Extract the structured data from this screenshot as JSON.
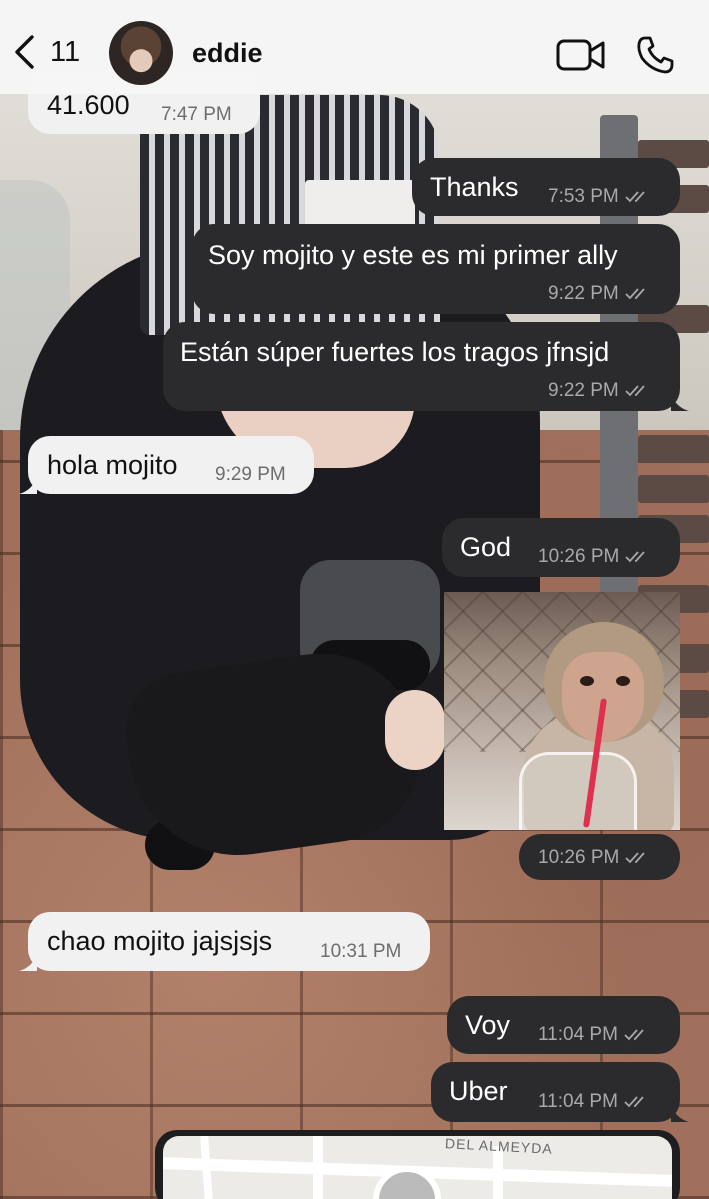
{
  "header": {
    "back_count": "11",
    "contact_name": "eddie"
  },
  "messages": [
    {
      "direction": "in",
      "text": "41.600",
      "time": "7:47 PM"
    },
    {
      "direction": "out",
      "text": "Thanks",
      "time": "7:53 PM",
      "status": "read"
    },
    {
      "direction": "out",
      "text": "Soy mojito y este es mi primer ally",
      "time": "9:22 PM",
      "status": "read"
    },
    {
      "direction": "out",
      "text": "Están súper fuertes los tragos jfnsjd",
      "time": "9:22 PM",
      "status": "read"
    },
    {
      "direction": "in",
      "text": "hola mojito",
      "time": "9:29 PM"
    },
    {
      "direction": "out",
      "text": "God",
      "time": "10:26 PM",
      "status": "read"
    },
    {
      "direction": "out",
      "type": "image",
      "time": "10:26 PM",
      "status": "read"
    },
    {
      "direction": "in",
      "text": "chao mojito jajsjsjs",
      "time": "10:31 PM"
    },
    {
      "direction": "out",
      "text": "Voy",
      "time": "11:04 PM",
      "status": "read"
    },
    {
      "direction": "out",
      "text": "Uber",
      "time": "11:04 PM",
      "status": "read"
    },
    {
      "direction": "out",
      "type": "location",
      "map_label": "DEL ALMEYDA"
    }
  ],
  "icons": {
    "back": "chevron-left-icon",
    "video": "video-camera-icon",
    "call": "phone-icon",
    "read_status": "double-check-icon"
  },
  "colors": {
    "outgoing_bubble": "#2b2b2d",
    "incoming_bubble": "#f1f1f1",
    "header_bg": "#f6f6f6"
  }
}
